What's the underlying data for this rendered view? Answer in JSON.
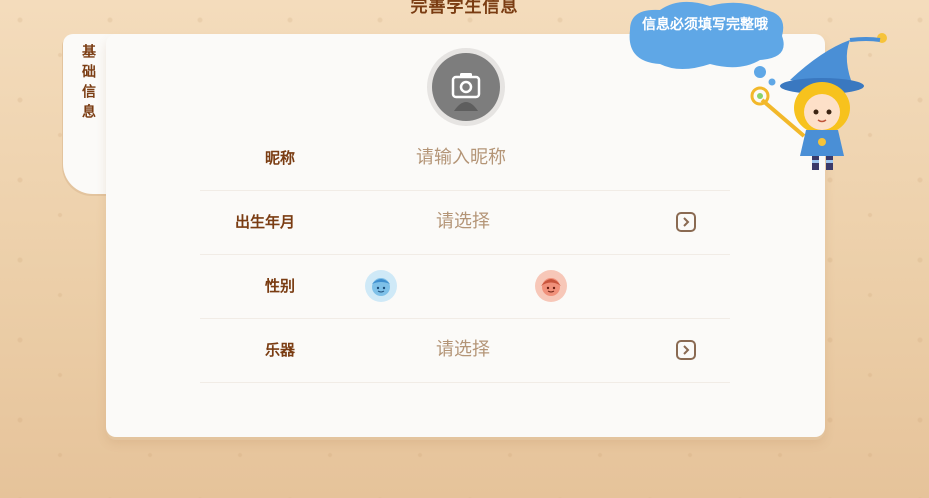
{
  "page": {
    "title": "完善学生信息"
  },
  "side_tab": {
    "label": "基础信息"
  },
  "bubble": {
    "text": "信息必须填写完整哦"
  },
  "form": {
    "nickname": {
      "label": "昵称",
      "placeholder": "请输入昵称"
    },
    "birth": {
      "label": "出生年月",
      "placeholder": "请选择"
    },
    "gender": {
      "label": "性别",
      "options": [
        "boy-icon",
        "girl-icon"
      ]
    },
    "instrument": {
      "label": "乐器",
      "placeholder": "请选择"
    }
  },
  "icons": {
    "camera": "camera-icon",
    "chevron": "chevron-right-icon"
  },
  "colors": {
    "brown": "#7a3c12",
    "placeholder": "#b49577",
    "bubble": "#5fa7e6",
    "card": "#fbfaf8"
  }
}
